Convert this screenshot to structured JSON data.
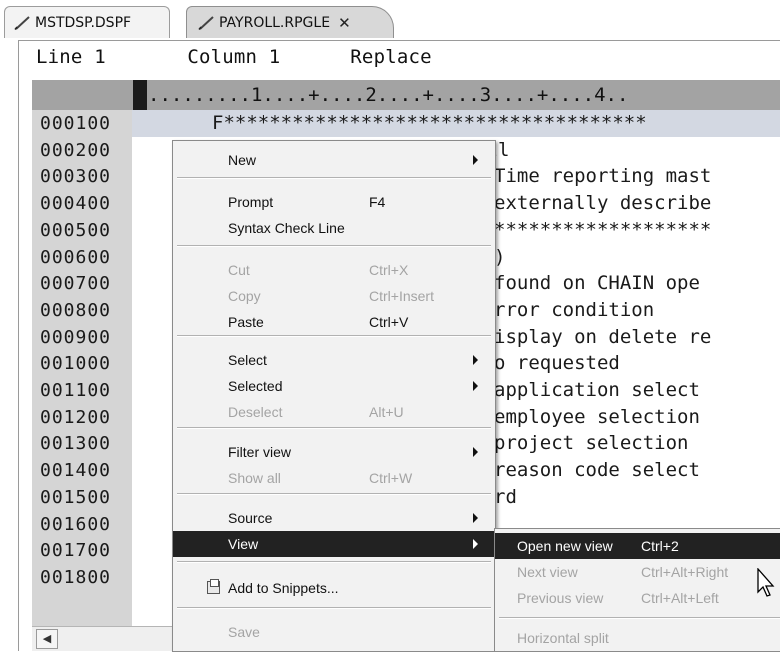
{
  "tabs": [
    {
      "label": "MSTDSP.DSPF",
      "icon": "pencil-icon"
    },
    {
      "label": "PAYROLL.RPGLE",
      "icon": "pencil-icon",
      "close": "✕"
    }
  ],
  "editor": {
    "status": {
      "line": "Line 1",
      "column": "Column 1",
      "mode": "Replace"
    },
    "ruler": ".........1....+....2....+....3....+....4..",
    "lines": [
      {
        "seq": "000100",
        "code": "F*************************************"
      },
      {
        "seq": "000200",
        "code": "F*  PROGRAM NAME - Payroll"
      },
      {
        "seq": "000300",
        "code": "Time reporting mast"
      },
      {
        "seq": "000400",
        "code": "externally describe"
      },
      {
        "seq": "000500",
        "code": "*******************"
      },
      {
        "seq": "000600",
        "code": ")"
      },
      {
        "seq": "000700",
        "code": "found on CHAIN ope"
      },
      {
        "seq": "000800",
        "code": "rror condition"
      },
      {
        "seq": "000900",
        "code": "isplay on delete re"
      },
      {
        "seq": "001000",
        "code": "o requested"
      },
      {
        "seq": "001100",
        "code": "application select"
      },
      {
        "seq": "001200",
        "code": "employee selection"
      },
      {
        "seq": "001300",
        "code": "project selection"
      },
      {
        "seq": "001400",
        "code": "reason code select"
      },
      {
        "seq": "001500",
        "code": "rd"
      },
      {
        "seq": "001600",
        "code": ""
      },
      {
        "seq": "001700",
        "code": ""
      },
      {
        "seq": "001800",
        "code": ""
      }
    ]
  },
  "context_menu": {
    "items": [
      {
        "label": "New",
        "submenu": true
      },
      {
        "label": "Prompt",
        "shortcut": "F4"
      },
      {
        "label": "Syntax Check Line"
      },
      {
        "label": "Cut",
        "shortcut": "Ctrl+X",
        "disabled": true
      },
      {
        "label": "Copy",
        "shortcut": "Ctrl+Insert",
        "disabled": true
      },
      {
        "label": "Paste",
        "shortcut": "Ctrl+V"
      },
      {
        "label": "Select",
        "submenu": true
      },
      {
        "label": "Selected",
        "submenu": true
      },
      {
        "label": "Deselect",
        "shortcut": "Alt+U",
        "disabled": true
      },
      {
        "label": "Filter view",
        "submenu": true
      },
      {
        "label": "Show all",
        "shortcut": "Ctrl+W",
        "disabled": true
      },
      {
        "label": "Source",
        "submenu": true
      },
      {
        "label": "View",
        "submenu": true,
        "highlighted": true
      },
      {
        "label": "Add to Snippets...",
        "icon": "snippets-icon"
      },
      {
        "label": "Save",
        "disabled": true
      }
    ]
  },
  "view_submenu": {
    "items": [
      {
        "label": "Open new view",
        "shortcut": "Ctrl+2",
        "highlighted": true
      },
      {
        "label": "Next view",
        "shortcut": "Ctrl+Alt+Right",
        "disabled": true
      },
      {
        "label": "Previous view",
        "shortcut": "Ctrl+Alt+Left",
        "disabled": true
      },
      {
        "label": "Horizontal split",
        "disabled": true
      }
    ]
  },
  "colors": {
    "highlight": "#222222",
    "gutter": "#d5d5d5",
    "ruler": "#a3a3a3",
    "disabled_text": "#a4a4a4"
  }
}
